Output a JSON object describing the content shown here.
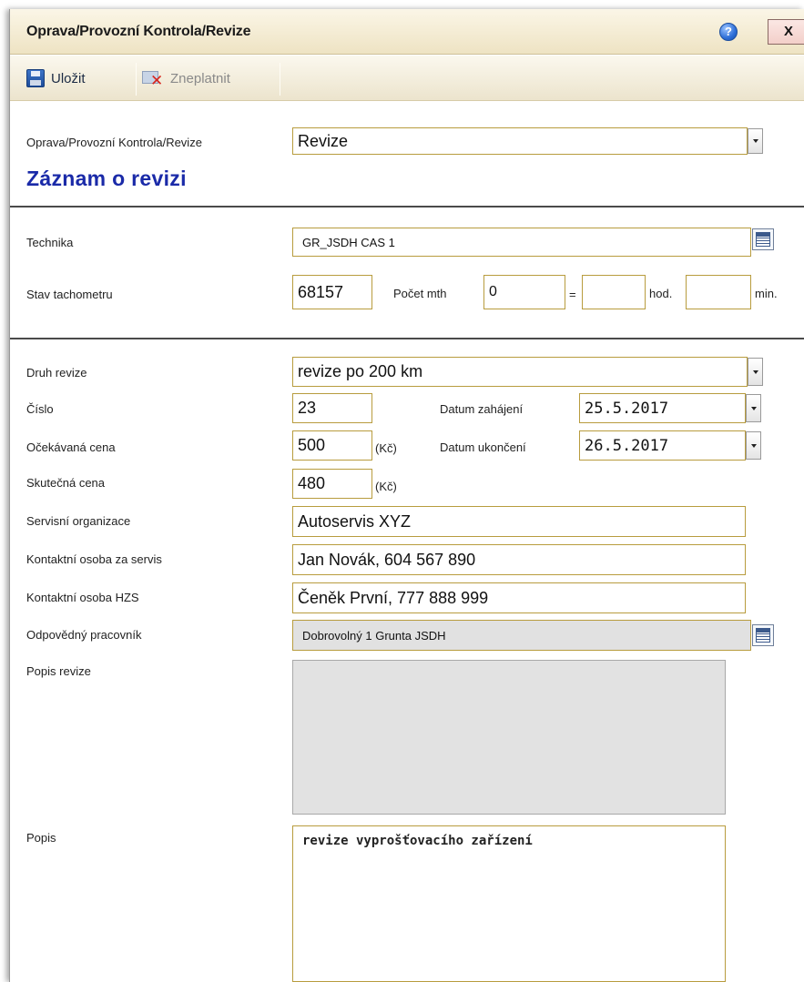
{
  "window": {
    "title": "Oprava/Provozní Kontrola/Revize",
    "close_label": "X",
    "help_label": "?"
  },
  "toolbar": {
    "save_label": "Uložit",
    "cancel_label": "Zneplatnit"
  },
  "form": {
    "type_label": "Oprava/Provozní Kontrola/Revize",
    "type_value": "Revize",
    "section_title": "Záznam o revizi",
    "technika_label": "Technika",
    "technika_value": "GR_JSDH CAS 1",
    "tacho_label": "Stav tachometru",
    "tacho_value": "68157",
    "mth_label": "Počet mth",
    "mth_value": "0",
    "equals": "=",
    "hod_value": "",
    "hod_label": "hod.",
    "min_value": "",
    "min_label": "min.",
    "druh_label": "Druh revize",
    "druh_value": "revize po 200 km",
    "cislo_label": "Číslo",
    "cislo_value": "23",
    "datum_zahajeni_label": "Datum zahájení",
    "datum_zahajeni_value": "25.5.2017",
    "ocekavana_label": "Očekávaná cena",
    "ocekavana_value": "500",
    "kc_label": "(Kč)",
    "datum_ukonceni_label": "Datum ukončení",
    "datum_ukonceni_value": "26.5.2017",
    "skutecna_label": "Skutečná cena",
    "skutecna_value": "480",
    "servisni_label": "Servisní organizace",
    "servisni_value": "Autoservis XYZ",
    "kontakt_servis_label": "Kontaktní osoba za servis",
    "kontakt_servis_value": "Jan Novák, 604 567 890",
    "kontakt_hzs_label": "Kontaktní osoba HZS",
    "kontakt_hzs_value": "Čeněk První, 777 888 999",
    "odpovedny_label": "Odpovědný pracovník",
    "odpovedny_value": "Dobrovolný 1 Grunta JSDH",
    "popis_revize_label": "Popis revize",
    "popis_revize_value": "",
    "popis_label": "Popis",
    "popis_value": "revize vyprošťovacího zařízení"
  }
}
